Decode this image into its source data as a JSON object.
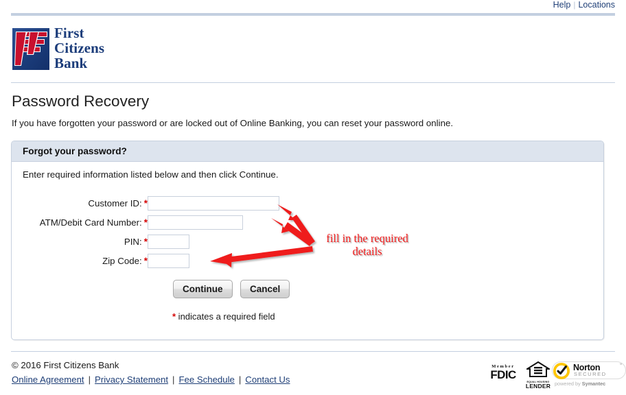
{
  "top_nav": {
    "help_label": "Help",
    "separator": "|",
    "locations_label": "Locations"
  },
  "brand": {
    "line1": "First",
    "line2": "Citizens",
    "line3": "Bank",
    "mark_icon": "first-citizens-logo-icon",
    "mark_blue": "#1b3c7a",
    "mark_red": "#c8102e"
  },
  "page": {
    "title": "Password Recovery",
    "intro": "If you have forgotten your password or are locked out of Online Banking, you can reset your password online."
  },
  "panel": {
    "header": "Forgot your password?",
    "instruction": "Enter required information listed below and then click Continue.",
    "fields": [
      {
        "label": "Customer ID:",
        "required_mark": "*",
        "value": "",
        "placeholder": "",
        "name": "customer-id"
      },
      {
        "label": "ATM/Debit Card Number:",
        "required_mark": "*",
        "value": "",
        "placeholder": "",
        "name": "atm-debit-card-number"
      },
      {
        "label": "PIN:",
        "required_mark": "*",
        "value": "",
        "placeholder": "",
        "name": "pin"
      },
      {
        "label": "Zip Code:",
        "required_mark": "*",
        "value": "",
        "placeholder": "",
        "name": "zip-code"
      }
    ],
    "continue_label": "Continue",
    "cancel_label": "Cancel",
    "required_star": "*",
    "required_note": " indicates a required field"
  },
  "annotation": {
    "text_line1": "fill in the required",
    "text_line2": "details",
    "color": "#ef1c1c",
    "arrow_count": 3
  },
  "footer": {
    "copyright": "© 2016 First Citizens Bank",
    "links": [
      {
        "label": "Online Agreement"
      },
      {
        "label": "Privacy Statement"
      },
      {
        "label": "Fee Schedule"
      },
      {
        "label": "Contact Us"
      }
    ],
    "link_separator": "|",
    "badges": {
      "fdic_member": "Member",
      "fdic_name": "FDIC",
      "ehl_sub": "EQUAL HOUSING",
      "ehl_main": "LENDER",
      "norton_word": "Norton",
      "norton_secured": "SECURED",
      "norton_tm": "™",
      "norton_powered_pre": "powered by ",
      "norton_powered_brand": "Symantec"
    }
  }
}
